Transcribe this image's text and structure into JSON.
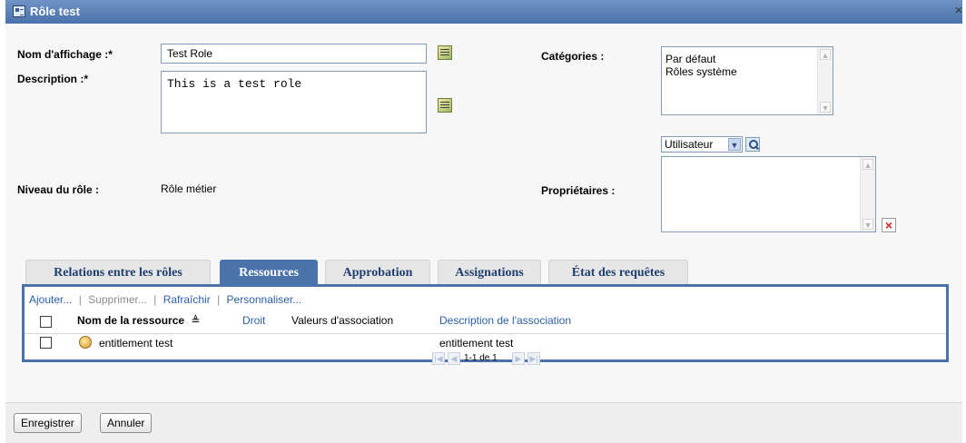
{
  "window": {
    "title": "Rôle test",
    "close_symbol": "×"
  },
  "form": {
    "display_name_label": "Nom d'affichage :*",
    "display_name_value": "Test Role",
    "description_label": "Description :*",
    "description_value": "This is a test role",
    "categories_label": "Catégories :",
    "categories": [
      "Par défaut",
      "Rôles système"
    ],
    "level_label": "Niveau du rôle :",
    "level_value": "Rôle métier",
    "owners_label": "Propriétaires :",
    "owner_type": "Utilisateur"
  },
  "tabs": [
    {
      "label": "Relations entre les rôles",
      "active": false
    },
    {
      "label": "Ressources",
      "active": true
    },
    {
      "label": "Approbation",
      "active": false
    },
    {
      "label": "Assignations",
      "active": false
    },
    {
      "label": "État des requêtes",
      "active": false
    }
  ],
  "resources": {
    "toolbar": {
      "add": "Ajouter...",
      "remove": "Supprimer...",
      "refresh": "Rafraîchir",
      "customize": "Personnaliser...",
      "separator": "|"
    },
    "columns": {
      "name": "Nom de la ressource",
      "sort_indicator": "≜",
      "right": "Droit",
      "assoc_values": "Valeurs d'association",
      "assoc_desc": "Description de l'association"
    },
    "rows": [
      {
        "name": "entitlement test",
        "right": "",
        "assoc_values": "",
        "assoc_desc": "entitlement test"
      }
    ],
    "pagination": "1-1 de 1"
  },
  "footer": {
    "save": "Enregistrer",
    "cancel": "Annuler"
  }
}
